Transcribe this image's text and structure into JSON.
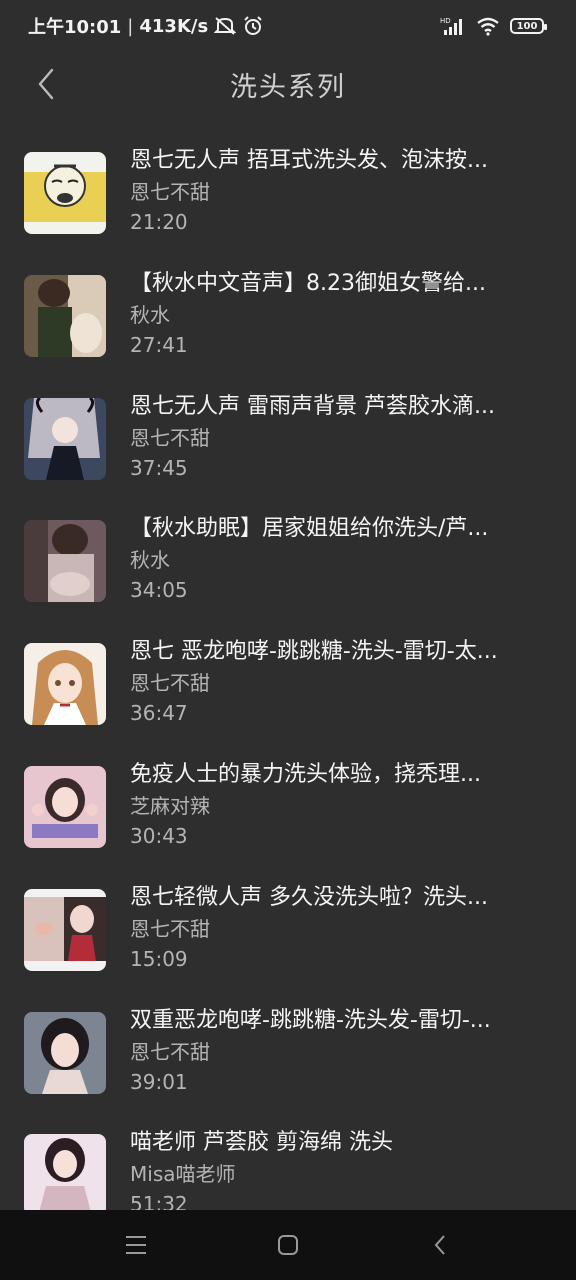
{
  "status_bar": {
    "time": "上午10:01",
    "separator": "|",
    "network_speed": "413K/s",
    "battery": "100",
    "icons": [
      "mute-icon",
      "alarm-icon",
      "signal-icon",
      "wifi-icon",
      "battery-icon"
    ],
    "hd_label": "HD"
  },
  "header": {
    "title": "洗头系列",
    "back_icon": "chevron-left-icon"
  },
  "items": [
    {
      "title": "恩七无人声 捂耳式洗头发、泡沫按...",
      "author": "恩七不甜",
      "duration": "21:20"
    },
    {
      "title": "【秋水中文音声】8.23御姐女警给...",
      "author": "秋水",
      "duration": "27:41"
    },
    {
      "title": "恩七无人声 雷雨声背景 芦荟胶水滴...",
      "author": "恩七不甜",
      "duration": "37:45"
    },
    {
      "title": "【秋水助眠】居家姐姐给你洗头/芦...",
      "author": "秋水",
      "duration": "34:05"
    },
    {
      "title": "恩七 恶龙咆哮-跳跳糖-洗头-雷切-太...",
      "author": "恩七不甜",
      "duration": "36:47"
    },
    {
      "title": "免疫人士的暴力洗头体验，挠秃理...",
      "author": "芝麻对辣",
      "duration": "30:43"
    },
    {
      "title": "恩七轻微人声 多久没洗头啦？洗头...",
      "author": "恩七不甜",
      "duration": "15:09"
    },
    {
      "title": "双重恶龙咆哮-跳跳糖-洗头发-雷切-...",
      "author": "恩七不甜",
      "duration": "39:01"
    },
    {
      "title": "喵老师 芦荟胶 剪海绵 洗头",
      "author": "Misa喵老师",
      "duration": "51:32"
    }
  ],
  "thumb_colors": [
    "#d9c25a",
    "#8a7a6a",
    "#5a6a7e",
    "#9a7a78",
    "#c9a070",
    "#c99ab0",
    "#b08070",
    "#6e7a8a",
    "#d7b9c2"
  ],
  "nav_bar": {
    "icons": [
      "menu-icon",
      "home-icon",
      "back-icon"
    ]
  }
}
